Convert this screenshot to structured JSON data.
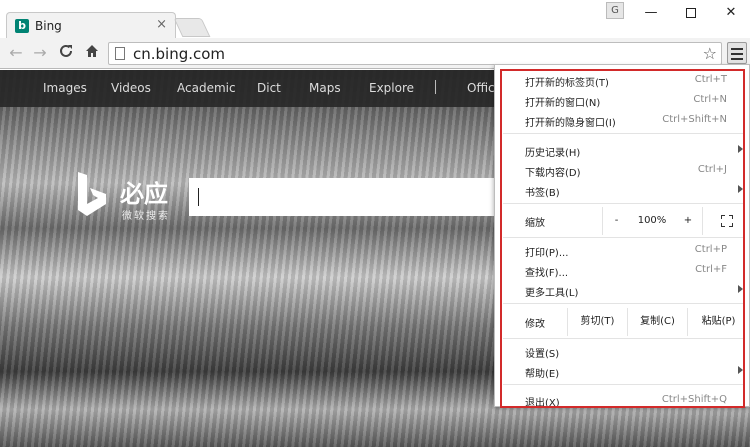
{
  "browser": {
    "tab": {
      "title": "Bing",
      "favicon_letter": "b",
      "close": "×"
    },
    "profile_label": "G",
    "window_buttons": {
      "minimize": "—",
      "close": "✕"
    },
    "toolbar": {
      "back": "←",
      "forward": "→",
      "reload": "C",
      "home": "⌂",
      "url": "cn.bing.com",
      "star": "☆"
    }
  },
  "bing": {
    "nav": [
      "Images",
      "Videos",
      "Academic",
      "Dict",
      "Maps",
      "Explore",
      "Office"
    ],
    "logo_text": "必应",
    "logo_subtitle": "微软搜索"
  },
  "menu": {
    "items_top": [
      {
        "label": "打开新的标签页(T)",
        "shortcut": "Ctrl+T"
      },
      {
        "label": "打开新的窗口(N)",
        "shortcut": "Ctrl+N"
      },
      {
        "label": "打开新的隐身窗口(I)",
        "shortcut": "Ctrl+Shift+N"
      }
    ],
    "items_history": [
      {
        "label": "历史记录(H)",
        "shortcut": ""
      },
      {
        "label": "下载内容(D)",
        "shortcut": "Ctrl+J"
      },
      {
        "label": "书签(B)",
        "shortcut": ""
      }
    ],
    "zoom": {
      "label": "缩放",
      "minus": "-",
      "value": "100%",
      "plus": "+"
    },
    "items_tools": [
      {
        "label": "打印(P)...",
        "shortcut": "Ctrl+P"
      },
      {
        "label": "查找(F)...",
        "shortcut": "Ctrl+F"
      },
      {
        "label": "更多工具(L)",
        "shortcut": ""
      }
    ],
    "edit": {
      "label": "修改",
      "cut": "剪切(T)",
      "copy": "复制(C)",
      "paste": "粘贴(P)"
    },
    "items_settings": [
      {
        "label": "设置(S)",
        "shortcut": ""
      },
      {
        "label": "帮助(E)",
        "shortcut": ""
      }
    ],
    "exit": {
      "label": "退出(X)",
      "shortcut": "Ctrl+Shift+Q"
    },
    "highlight_color": "#d22a2a"
  }
}
